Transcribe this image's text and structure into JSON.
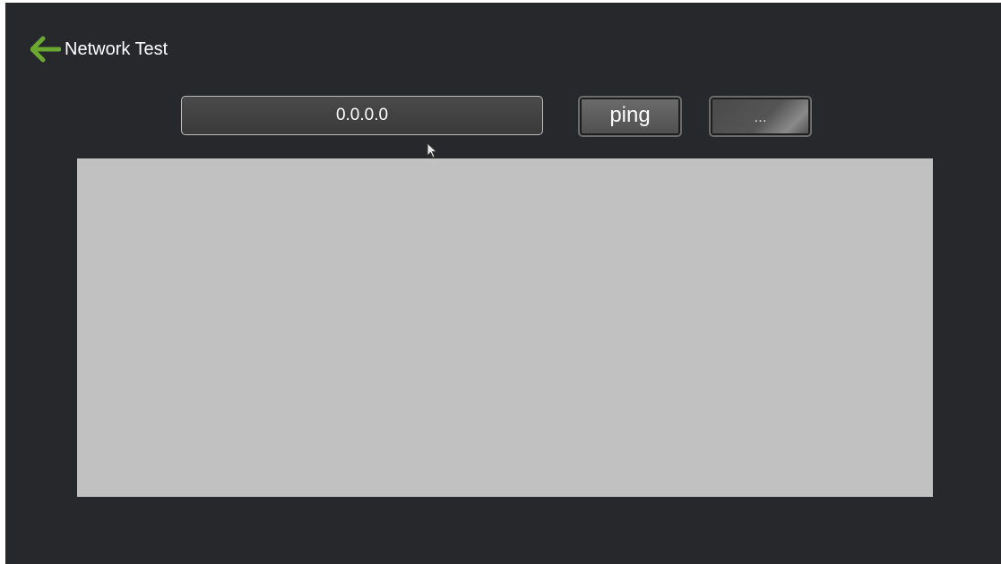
{
  "header": {
    "title": "Network Test",
    "back_icon": "arrow-left-icon",
    "back_icon_color": "#6aa832"
  },
  "ping_form": {
    "ip_value": "0.0.0.0",
    "ping_label": "ping",
    "more_label": "..."
  },
  "output": {
    "text": ""
  },
  "colors": {
    "background": "#27282c",
    "panel": "#c1c1c1"
  }
}
